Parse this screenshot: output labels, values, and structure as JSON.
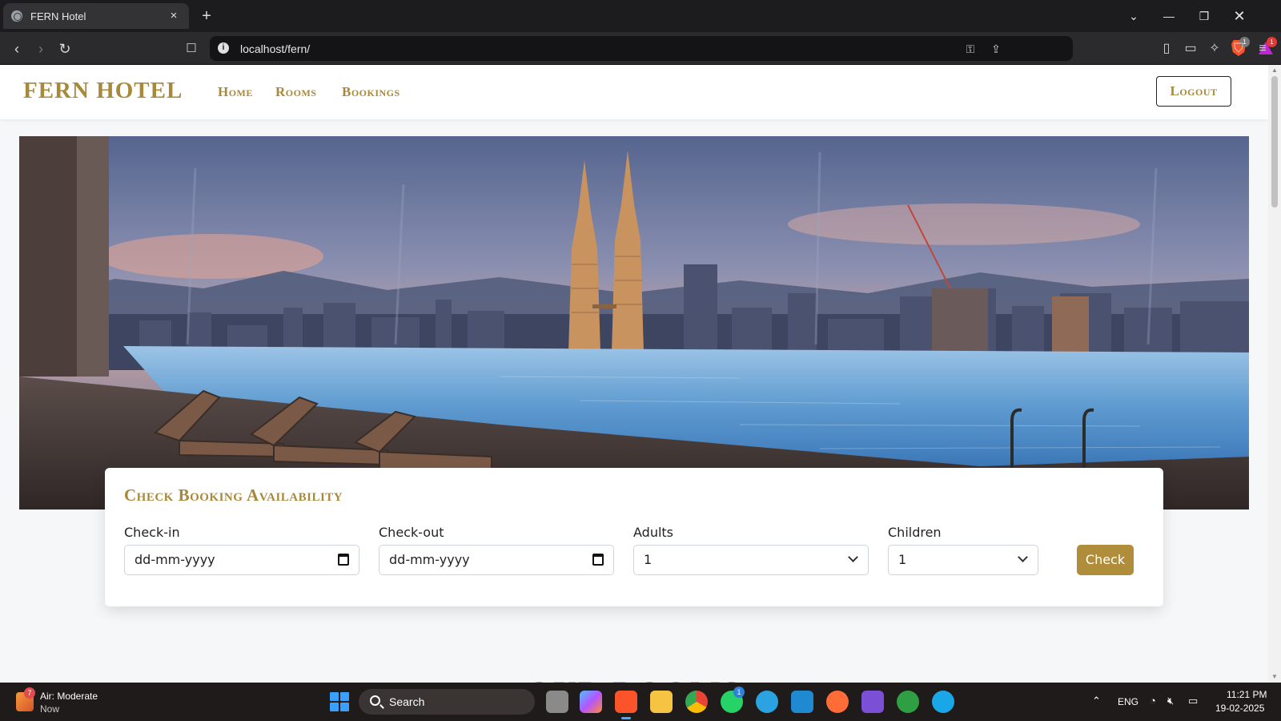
{
  "browser": {
    "tab_title": "FERN Hotel",
    "tab_close": "×",
    "new_tab": "+",
    "url": "localhost/fern/",
    "brave_shield_badge": "1",
    "brave_rewards_badge": "1"
  },
  "site": {
    "logo": "FERN HOTEL",
    "nav": [
      "Home",
      "Rooms",
      "Bookings"
    ],
    "logout_label": "Logout"
  },
  "booking": {
    "title": "Check Booking Availability",
    "checkin_label": "Check-in",
    "checkin_placeholder": "dd-mm-yyyy",
    "checkout_label": "Check-out",
    "checkout_placeholder": "dd-mm-yyyy",
    "adults_label": "Adults",
    "adults_value": "1",
    "children_label": "Children",
    "children_value": "1",
    "check_label": "Check"
  },
  "section": {
    "our_rooms": "OUR ROOMS"
  },
  "taskbar": {
    "weather_title": "Air: Moderate",
    "weather_sub": "Now",
    "weather_badge": "7",
    "search_label": "Search",
    "whatsapp_badge": "1",
    "lang": "ENG",
    "time": "11:21 PM",
    "date": "19-02-2025"
  }
}
